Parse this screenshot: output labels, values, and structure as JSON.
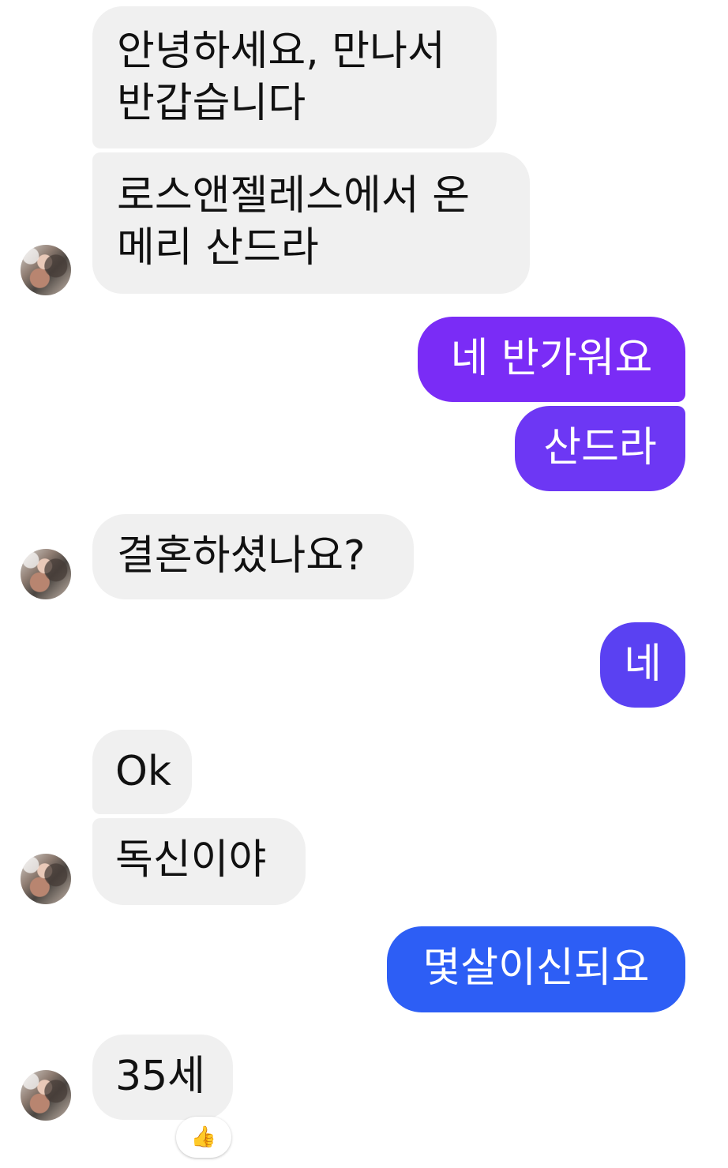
{
  "messages": {
    "m1": "안녕하세요, 만나서",
    "m1_line2": "반갑습니다",
    "m2": "로스앤젤레스에서 온",
    "m2_line2": "메리 산드라",
    "m3": "네 반가워요",
    "m4": "산드라",
    "m5": "결혼하셨나요?",
    "m6": "네",
    "m7": "Ok",
    "m8": "독신이야",
    "m9": "몇살이신되요",
    "m10": "35세"
  },
  "reaction": {
    "emoji": "👍",
    "icon": "thumbs-up-icon"
  },
  "colors": {
    "incoming_bg": "#f0f0f0",
    "outgoing_purple": "#7a2cf6",
    "outgoing_violet": "#6d37f4",
    "outgoing_indigo": "#5a41f2",
    "outgoing_blue": "#2d5ef5"
  }
}
